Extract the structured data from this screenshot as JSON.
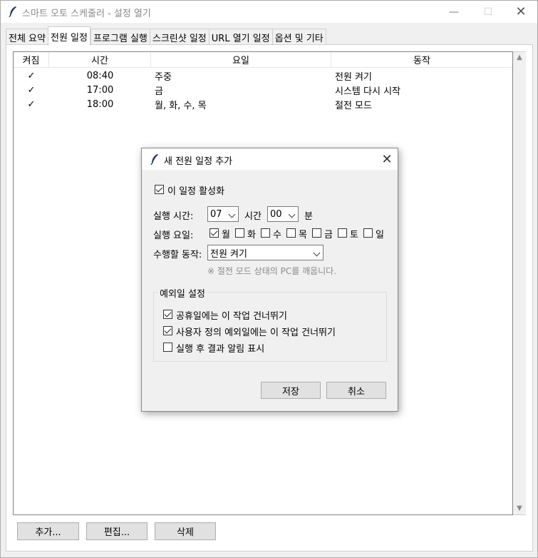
{
  "window": {
    "title": "스마트 오토 스케줄러 - 설정 열기",
    "controls": {
      "minimize": "—",
      "maximize": "☐",
      "close": "✕"
    }
  },
  "tabs": [
    {
      "label": "전체 요약",
      "active": false
    },
    {
      "label": "전원 일정",
      "active": true
    },
    {
      "label": "프로그램 실행",
      "active": false
    },
    {
      "label": "스크린샷 일정",
      "active": false
    },
    {
      "label": "URL 열기 일정",
      "active": false
    },
    {
      "label": "옵션 및 기타",
      "active": false
    }
  ],
  "schedule_table": {
    "columns": [
      "켜짐",
      "시간",
      "요일",
      "동작"
    ],
    "rows": [
      {
        "enabled": "✓",
        "time": "08:40",
        "days": "주중",
        "action": "전원 켜기"
      },
      {
        "enabled": "✓",
        "time": "17:00",
        "days": "금",
        "action": "시스템 다시 시작"
      },
      {
        "enabled": "✓",
        "time": "18:00",
        "days": "월, 화, 수, 목",
        "action": "절전 모드"
      }
    ]
  },
  "buttons": {
    "add": "추가...",
    "edit": "편집...",
    "delete": "삭제"
  },
  "dialog": {
    "title": "새 전원 일정 추가",
    "close": "✕",
    "enable_label": "이 일정 활성화",
    "enable_checked": true,
    "time_label": "실행 시간:",
    "hour_value": "07",
    "hour_unit": "시간",
    "minute_value": "00",
    "minute_unit": "분",
    "days_label": "실행 요일:",
    "days": [
      {
        "label": "월",
        "checked": true
      },
      {
        "label": "화",
        "checked": false
      },
      {
        "label": "수",
        "checked": false
      },
      {
        "label": "목",
        "checked": false
      },
      {
        "label": "금",
        "checked": false
      },
      {
        "label": "토",
        "checked": false
      },
      {
        "label": "일",
        "checked": false
      }
    ],
    "action_label": "수행할 동작:",
    "action_value": "전원 켜기",
    "action_hint": "※ 절전 모드 상태의 PC를 깨웁니다.",
    "exceptions": {
      "title": "예외일 설정",
      "options": [
        {
          "label": "공휴일에는 이 작업 건너뛰기",
          "checked": true
        },
        {
          "label": "사용자 정의 예외일에는 이 작업 건너뛰기",
          "checked": true
        },
        {
          "label": "실행 후 결과 알림 표시",
          "checked": false
        }
      ]
    },
    "save": "저장",
    "cancel": "취소"
  },
  "colors": {
    "window_bg": "#f0f0f0",
    "title_text": "#8a8a8a",
    "hint_text": "#8a8a8a",
    "button_bg": "#e1e1e1"
  }
}
